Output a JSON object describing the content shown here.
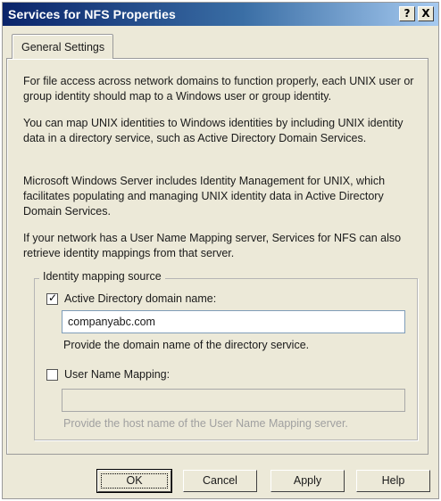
{
  "window": {
    "title": "Services for NFS Properties"
  },
  "titlebar": {
    "help_glyph": "?",
    "close_glyph": "X"
  },
  "tabs": [
    {
      "label": "General Settings"
    }
  ],
  "paragraphs": [
    "For file access across network domains to function properly, each UNIX user or group identity should map to a Windows user or group identity.",
    "You can map UNIX identities to Windows identities by including UNIX identity data in a directory service, such as Active Directory Domain Services.",
    "Microsoft Windows Server includes Identity Management for UNIX, which facilitates populating and managing UNIX identity data in Active Directory Domain Services.",
    "If your network has a User Name Mapping server, Services for NFS can also retrieve identity mappings from that server."
  ],
  "group": {
    "title": "Identity mapping source",
    "ad_option": {
      "label": "Active Directory domain name:",
      "checked": true,
      "value": "companyabc.com",
      "help": "Provide the domain name of the directory service."
    },
    "unm_option": {
      "label": "User Name Mapping:",
      "checked": false,
      "value": "",
      "help": "Provide the host name of the User Name Mapping server."
    }
  },
  "buttons": {
    "ok": "OK",
    "cancel": "Cancel",
    "apply": "Apply",
    "help": "Help"
  }
}
